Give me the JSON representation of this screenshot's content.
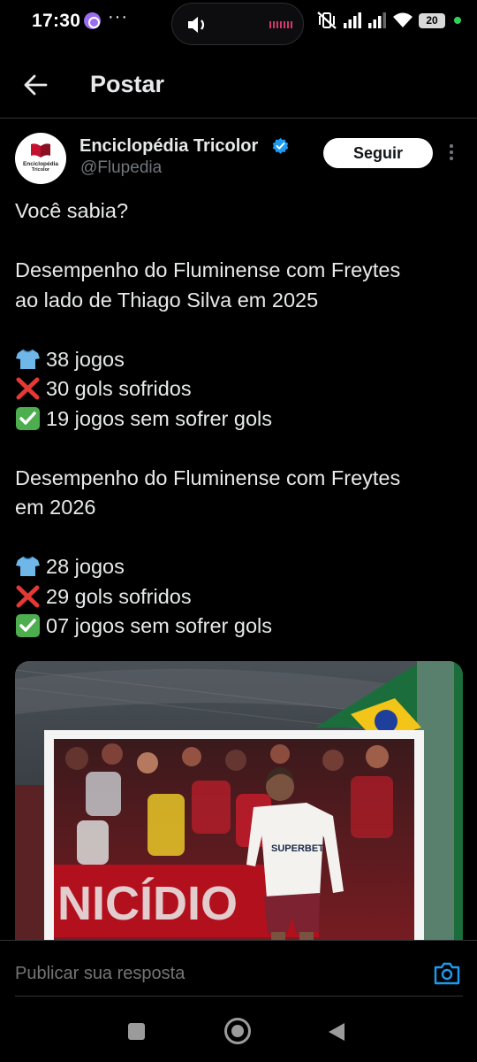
{
  "status_bar": {
    "time": "17:30",
    "more": "···",
    "battery": "20"
  },
  "header": {
    "title": "Postar"
  },
  "post": {
    "author_name": "Enciclopédia Tricolor",
    "handle": "@Flupedia",
    "follow_label": "Seguir",
    "avatar_text_1": "Enciclopédia",
    "avatar_text_2": "Tricolor",
    "lines": [
      "Você sabia?",
      "",
      "Desempenho do Fluminense com Freytes",
      "ao lado de Thiago Silva em 2025",
      "",
      "38 jogos",
      "30 gols sofridos",
      "19 jogos sem sofrer gols",
      "",
      "Desempenho do Fluminense com Freytes",
      "em 2026",
      "",
      "28 jogos",
      "29 gols sofridos",
      "07 jogos sem sofrer gols"
    ],
    "image": {
      "banner_text": "NICÍDIO",
      "shirt_sponsor": "SUPERBET"
    }
  },
  "reply": {
    "placeholder": "Publicar sua resposta"
  },
  "icons": {
    "back": "arrow-left-icon",
    "verified": "verified-badge-icon",
    "more": "more-vertical-icon",
    "camera": "camera-icon",
    "shirt": "shirt-emoji",
    "cross": "cross-mark-emoji",
    "check": "check-mark-emoji"
  },
  "colors": {
    "background": "#000000",
    "text": "#e7e9ea",
    "muted": "#71767b",
    "accent": "#1d9bf0",
    "divider": "#2f3336"
  }
}
